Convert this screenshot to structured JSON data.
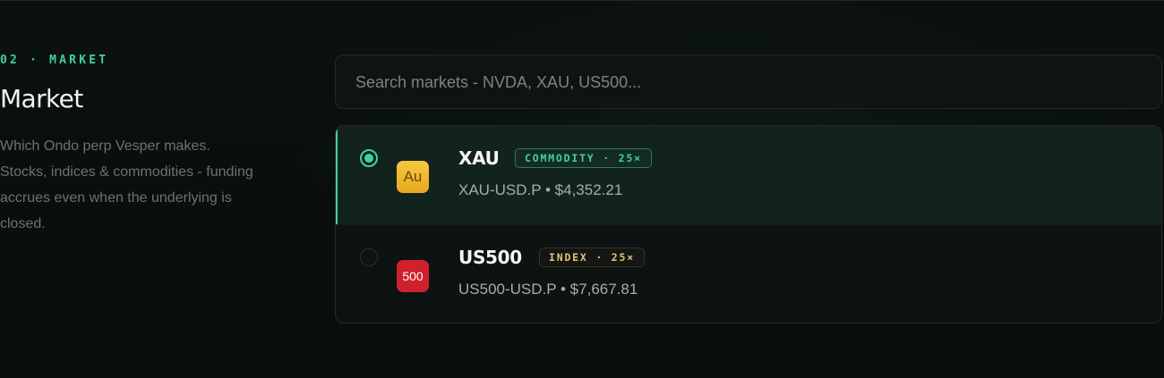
{
  "section": {
    "eyebrow": "02 · MARKET",
    "title": "Market",
    "description": "Which Ondo perp Vesper makes. Stocks, indices & commodities - funding accrues even when the underlying is closed."
  },
  "search": {
    "placeholder": "Search markets - NVDA, XAU, US500..."
  },
  "markets": [
    {
      "symbol": "XAU",
      "badge": "COMMODITY · 25×",
      "pair_price": "XAU-USD.P • $4,352.21",
      "icon_text": "Au",
      "icon": "gold-icon",
      "selected": true
    },
    {
      "symbol": "US500",
      "badge": "INDEX · 25×",
      "pair_price": "US500-USD.P • $7,667.81",
      "icon_text": "500",
      "icon": "us500-icon",
      "selected": false
    }
  ],
  "colors": {
    "accent": "#3fd39a",
    "background": "#0a0e0d",
    "index_badge": "#e3c27b",
    "gold_icon": "#f2bd35",
    "us500_icon": "#d0202d"
  }
}
